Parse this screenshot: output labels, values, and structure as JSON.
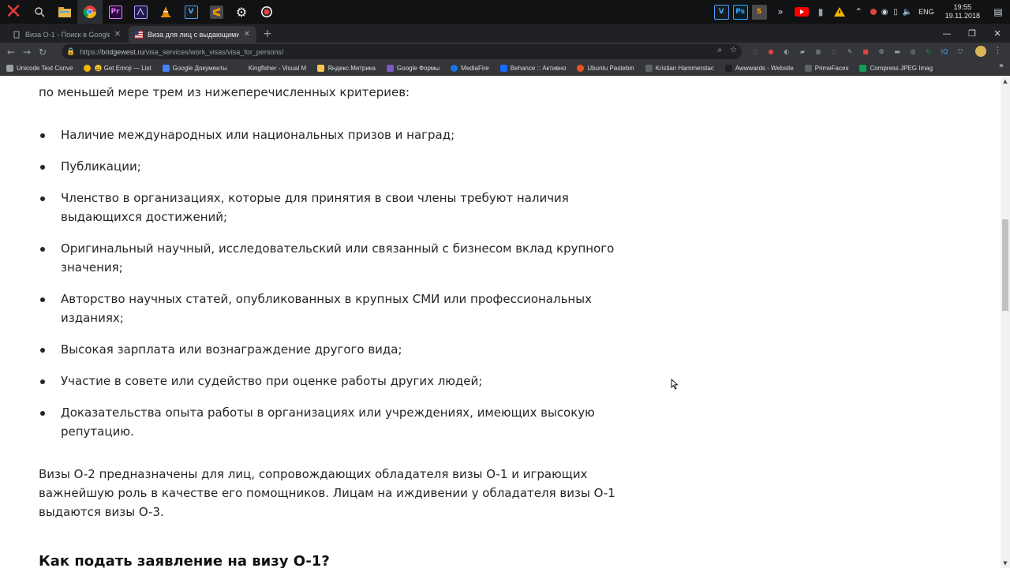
{
  "taskbar": {
    "apps": [
      {
        "name": "xampp",
        "glyph": "X",
        "color": "#e23b3b"
      },
      {
        "name": "search",
        "glyph": "⌕"
      },
      {
        "name": "file-explorer",
        "glyph": "",
        "color": "#e8b84a"
      },
      {
        "name": "chrome",
        "glyph": "",
        "color": "#4285f4"
      },
      {
        "name": "premiere",
        "glyph": "Pr",
        "color": "#2b0a3d"
      },
      {
        "name": "after-effects",
        "glyph": "",
        "color": "#1f1b4a"
      },
      {
        "name": "vlc",
        "glyph": "",
        "color": "#f08a00"
      },
      {
        "name": "visual-studio",
        "glyph": "V",
        "color": "#1a1a1a"
      },
      {
        "name": "sublime-text",
        "glyph": "",
        "color": "#ff9800"
      },
      {
        "name": "settings",
        "glyph": "⚙"
      },
      {
        "name": "obs",
        "glyph": "●",
        "color": "#e0443f"
      }
    ],
    "tray": {
      "language": "ENG",
      "time": "19:55",
      "date": "19.11.2018"
    }
  },
  "browser": {
    "tabs": [
      {
        "title": "Виза O-1 - Поиск в Google",
        "active": false
      },
      {
        "title": "Виза для лиц с выдающимися с",
        "active": true
      }
    ],
    "url": {
      "scheme": "https://",
      "host": "bridgewest.ru",
      "path": "/visa_services/work_visas/visa_for_persons/"
    },
    "bookmarks": [
      {
        "label": "Unicode Text Conve",
        "color": "#9aa0a6"
      },
      {
        "label": "😀 Get Emoji — List",
        "color": "#f4b400"
      },
      {
        "label": "Google Документы",
        "color": "#4285f4"
      },
      {
        "label": "Kingfisher - Visual M",
        "color": "#2b2b2b"
      },
      {
        "label": "Яндекс.Метрика",
        "color": "#f9c74f"
      },
      {
        "label": "Google Формы",
        "color": "#7e57c2"
      },
      {
        "label": "MediaFire",
        "color": "#1a73e8"
      },
      {
        "label": "Behance :: Активно",
        "color": "#1769ff"
      },
      {
        "label": "Ubuntu Pastebin",
        "color": "#e95420"
      },
      {
        "label": "Kristian Hammerstac",
        "color": "#5f6368"
      },
      {
        "label": "Awwwards - Website",
        "color": "#202124"
      },
      {
        "label": "PrimeFaces",
        "color": "#5f6368"
      },
      {
        "label": "Compress JPEG Imag",
        "color": "#0f9d58"
      }
    ]
  },
  "article": {
    "intro_tail": "по меньшей мере трем из нижеперечисленных критериев:",
    "criteria": [
      "Наличие международных или национальных призов и наград;",
      "Публикации;",
      "Членство в организациях, которые для принятия в свои члены требуют наличия выдающихся достижений;",
      "Оригинальный научный, исследовательский или связанный с бизнесом вклад крупного значения;",
      "Авторство научных статей, опубликованных в крупных СМИ или профессиональных изданиях;",
      "Высокая зарплата или вознаграждение другого вида;",
      "Участие в совете или судейство при оценке работы других людей;",
      "Доказательства опыта работы в организациях или учреждениях, имеющих высокую репутацию."
    ],
    "o2_paragraph": "Визы O-2 предназначены для лиц, сопровождающих обладателя визы O-1 и играющих важнейшую роль в качестве его помощников. Лицам на иждивении у обладателя визы O-1 выдаются визы O-3.",
    "next_heading": "Как подать заявление на визу O-1?"
  }
}
